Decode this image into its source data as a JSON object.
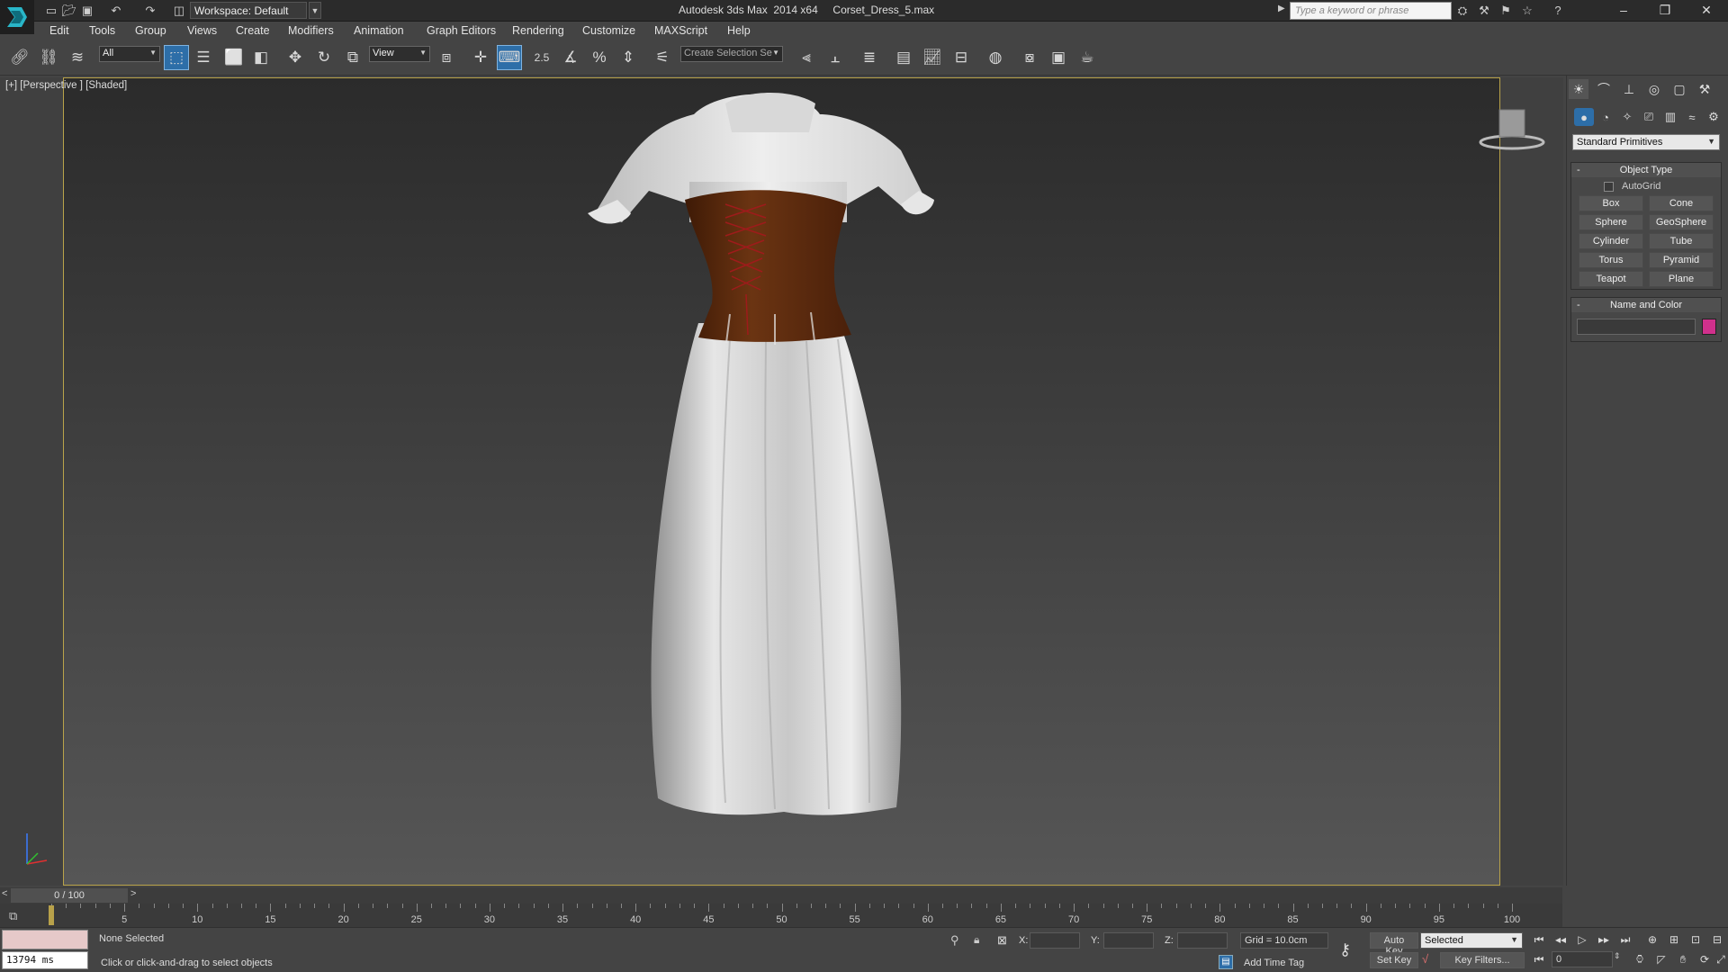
{
  "colors": {
    "accent": "#2d6ea8",
    "viewport_border": "#b9a34a",
    "object_color": "#d0308c",
    "corset": "#5a2a0e",
    "fabric": "#d9d9d9"
  },
  "titlebar": {
    "workspace": "Workspace: Default",
    "app_title": "Autodesk 3ds Max  2014 x64     Corset_Dress_5.max",
    "search_placeholder": "Type a keyword or phrase"
  },
  "menu": [
    "Edit",
    "Tools",
    "Group",
    "Views",
    "Create",
    "Modifiers",
    "Animation",
    "Graph Editors",
    "Rendering",
    "Customize",
    "MAXScript",
    "Help"
  ],
  "toolbar": {
    "selection_filter": "All",
    "ref_coord": "View",
    "snap_value": "2.5",
    "named_selection": "Create Selection Se"
  },
  "viewport": {
    "label": "[+] [Perspective ] [Shaded]"
  },
  "command_panel": {
    "category": "Standard Primitives",
    "object_type_title": "Object Type",
    "autogrid": "AutoGrid",
    "primitives": [
      "Box",
      "Cone",
      "Sphere",
      "GeoSphere",
      "Cylinder",
      "Tube",
      "Torus",
      "Pyramid",
      "Teapot",
      "Plane"
    ],
    "name_color_title": "Name and Color",
    "name_value": ""
  },
  "timeline": {
    "slider_label": "0 / 100",
    "prev": "<",
    "next": ">",
    "ticks": [
      "5",
      "10",
      "15",
      "20",
      "25",
      "30",
      "35",
      "40",
      "45",
      "50",
      "55",
      "60",
      "65",
      "70",
      "75",
      "80",
      "85",
      "90",
      "95",
      "100"
    ]
  },
  "status": {
    "script_time": "13794 ms",
    "selection": "None Selected",
    "prompt": "Click or click-and-drag to select objects",
    "x_label": "X:",
    "y_label": "Y:",
    "z_label": "Z:",
    "grid": "Grid = 10.0cm",
    "add_time_tag": "Add Time Tag",
    "auto_key": "Auto Key",
    "set_key": "Set Key",
    "key_mode": "Selected",
    "key_filters": "Key Filters...",
    "frame": "0"
  }
}
